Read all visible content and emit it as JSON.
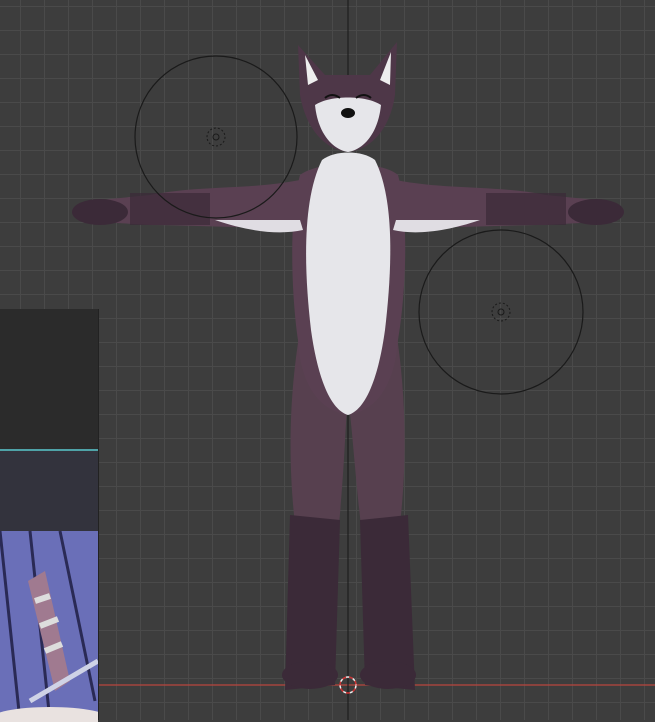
{
  "viewport": {
    "mode": "front-orthographic",
    "colors": {
      "background": "#3d3d3d",
      "grid": "#4a4a4a",
      "x_axis": "#b8453e",
      "z_axis": "#1e1e1e",
      "fur_dark": "#4e3748",
      "fur_light": "#e6e6ea",
      "accent_panel": "#4fa3a8"
    }
  },
  "objects": [
    {
      "type": "character-model"
    },
    {
      "type": "light",
      "name": "light-left"
    },
    {
      "type": "light",
      "name": "light-right"
    },
    {
      "type": "3d-cursor"
    }
  ]
}
